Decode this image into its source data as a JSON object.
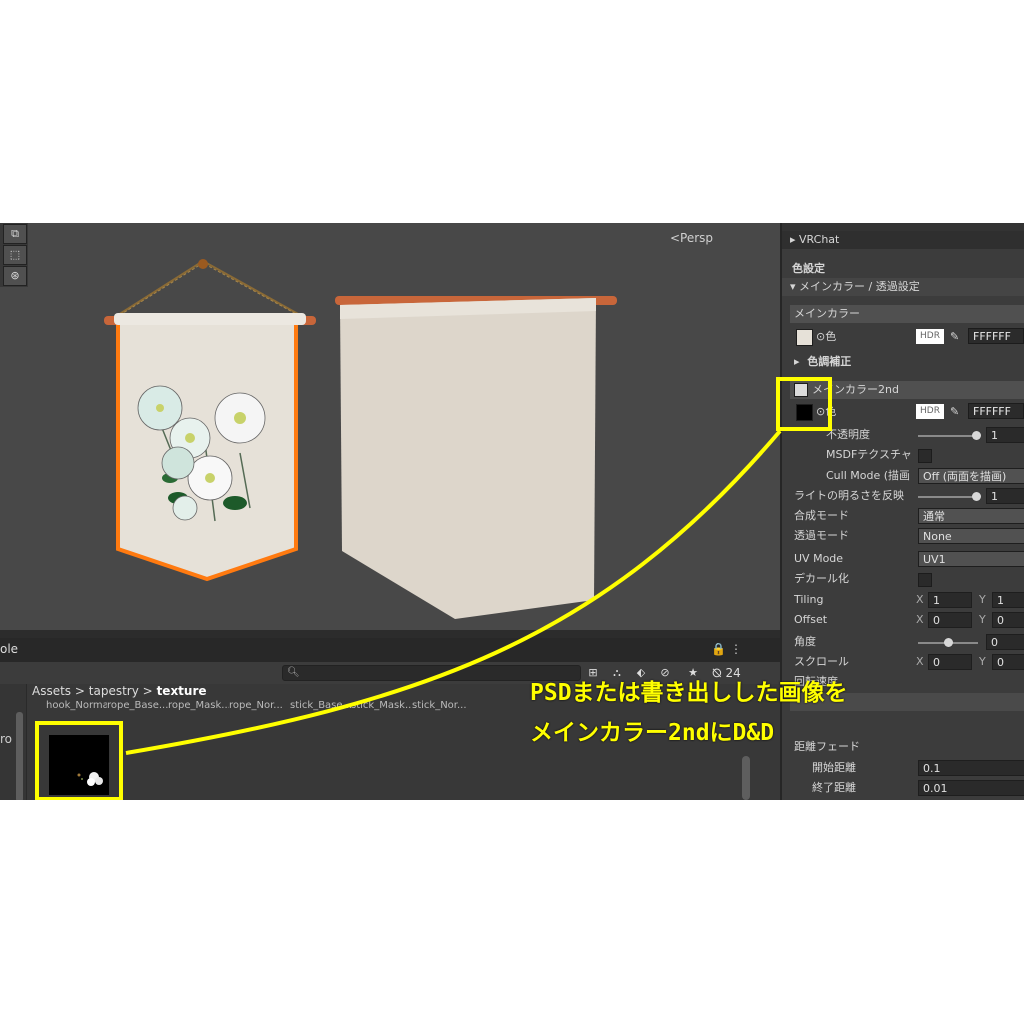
{
  "scene": {
    "persp_label": "<Persp",
    "tool_icons": [
      "rect-tool-icon",
      "transform-tool-icon",
      "custom-tool-icon"
    ]
  },
  "project": {
    "tab_label": "ole",
    "lock_icon": "lock-icon",
    "menu_icon": "kebab-menu-icon",
    "search_placeholder": "",
    "hidden_count": "24",
    "left_tree_text": "ro",
    "breadcrumb": {
      "part1": "Assets",
      "sep1": ">",
      "part2": "tapestry",
      "sep2": ">",
      "current": "texture"
    },
    "asset_labels": [
      "hook_Normal",
      "rope_Base...",
      "rope_Mask...",
      "rope_Nor...",
      "stick_Base...",
      "stick_Mask...",
      "stick_Nor..."
    ]
  },
  "inspector": {
    "vrchat": "VRChat",
    "color_settings": "色設定",
    "main_color_transparency": "メインカラー / 透過設定",
    "main_color": "メインカラー",
    "color_label": "⊙色",
    "hdr": "HDR",
    "main_hex": "FFFFFF",
    "color_correction": "色調補正",
    "main_color_2nd": "メインカラー2nd",
    "color_label_2": "⊙色",
    "hex_2nd": "FFFFFF",
    "opacity_label": "不透明度",
    "opacity_value": "1",
    "msdf_label": "MSDFテクスチャ",
    "cull_label": "Cull Mode (描画",
    "cull_value": "Off (両面を描画)",
    "light_label": "ライトの明るさを反映",
    "light_value": "1",
    "blend_label": "合成モード",
    "blend_value": "通常",
    "transp_label": "透過モード",
    "transp_value": "None",
    "uv_label": "UV Mode",
    "uv_value": "UV1",
    "decal_label": "デカール化",
    "tiling_label": "Tiling",
    "tiling_x": "1",
    "tiling_y": "1",
    "offset_label": "Offset",
    "offset_x": "0",
    "offset_y": "0",
    "angle_label": "角度",
    "angle_value": "0",
    "scroll_label": "スクロール",
    "scroll_x": "0",
    "scroll_y": "0",
    "rotation_label": "回転速度",
    "distance_fade": "距離フェード",
    "fade_start_label": "開始距離",
    "fade_start_value": "0.1",
    "fade_end_label": "終了距離",
    "fade_end_value": "0.01",
    "x_axis": "X",
    "y_axis": "Y"
  },
  "annotation": {
    "line1": "PSDまたは書き出しした画像を",
    "line2": "メインカラー2ndにD&D",
    "color": "#ffff00"
  }
}
